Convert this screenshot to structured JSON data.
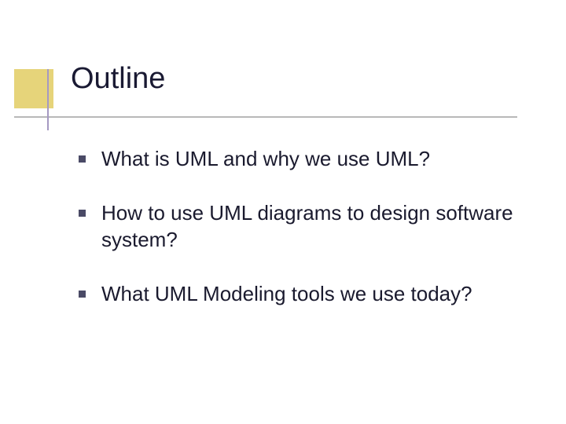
{
  "title": "Outline",
  "bullets": [
    {
      "text": "What is UML and why we use UML?"
    },
    {
      "text": "How to use UML diagrams to design software system?"
    },
    {
      "text": "What UML Modeling tools we use today?"
    }
  ],
  "colors": {
    "accent_box": "#e6d47a",
    "rule_h": "#b8b8b8",
    "rule_v": "#a599c2",
    "bullet": "#4a4a66"
  }
}
